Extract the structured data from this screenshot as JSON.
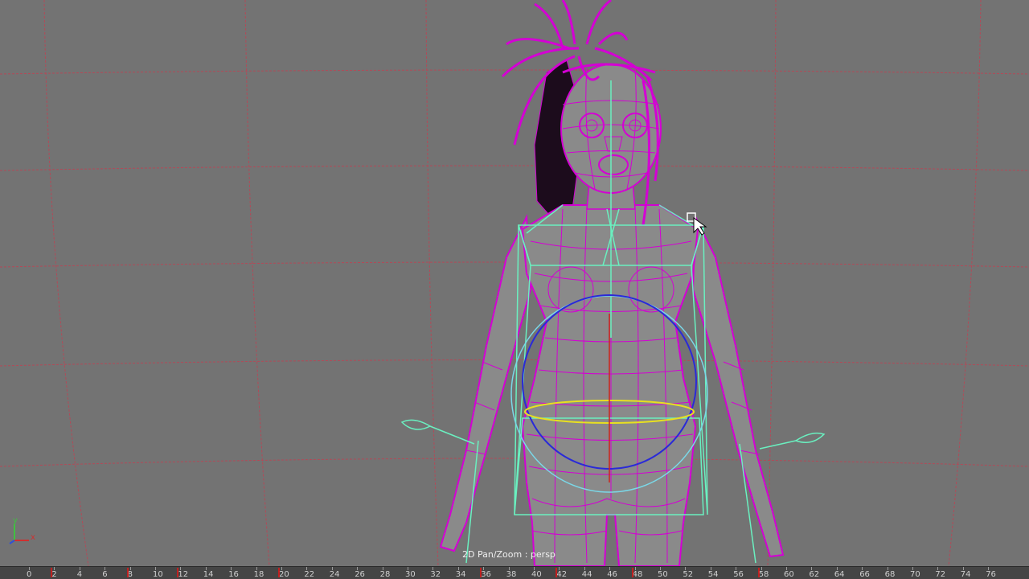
{
  "viewport": {
    "camera_label": "2D Pan/Zoom : persp",
    "axis": {
      "y": "y",
      "x": "x"
    },
    "colors": {
      "background": "#737373",
      "grid": "#b8505a",
      "mesh": "#d400d4",
      "rig": "#6af0c0",
      "hair_dark": "#1a0a1a",
      "skin": "#8a8a8a"
    }
  },
  "timeline": {
    "ticks": [
      "0",
      "2",
      "4",
      "6",
      "8",
      "10",
      "12",
      "14",
      "16",
      "18",
      "20",
      "22",
      "24",
      "26",
      "28",
      "30",
      "32",
      "34",
      "36",
      "38",
      "40",
      "42",
      "44",
      "46",
      "48",
      "50",
      "52",
      "54",
      "56",
      "58",
      "60",
      "62",
      "64",
      "66",
      "68",
      "70",
      "72",
      "74",
      "76"
    ],
    "keyframes": [
      "2",
      "8",
      "12",
      "20",
      "36",
      "42",
      "48",
      "58"
    ]
  }
}
